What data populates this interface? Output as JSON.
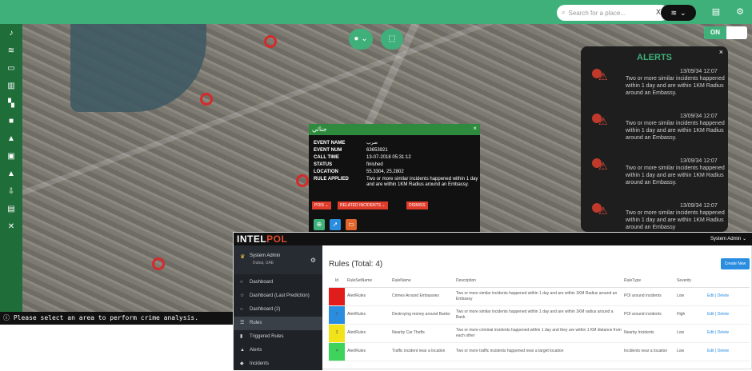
{
  "topbar": {
    "search_placeholder": "Search for a place...",
    "clear_label": "X",
    "layers_icon": "layers-icon",
    "chevron": "⌄"
  },
  "map": {
    "toggle_label": "ON",
    "status_message": "Please select an area to perform crime analysis."
  },
  "alerts": {
    "title": "ALERTS",
    "close": "×",
    "items": [
      {
        "time": "13/09/34 12:07",
        "message": "Two or more similar incidents happened within 1 day and are within 1KM Radius around an Embassy."
      },
      {
        "time": "13/09/34 12:07",
        "message": "Two or more similar incidents happened within 1 day and are within 1KM Radius around an Embassy."
      },
      {
        "time": "13/09/34 12:07",
        "message": "Two or more similar incidents happened within 1 day and are within 1KM Radius around an Embassy."
      },
      {
        "time": "13/09/34 12:07",
        "message": "Two or more similar incidents happened within 1 day and are within 1KM Radius around an Embassy"
      }
    ]
  },
  "popup": {
    "title": "جنائي",
    "close": "×",
    "fields": [
      {
        "key": "EVENT NAME",
        "value": "ضرب"
      },
      {
        "key": "EVENT NUM",
        "value": "63653921"
      },
      {
        "key": "CALL TIME",
        "value": "13-07-2018 05:31:12"
      },
      {
        "key": "STATUS",
        "value": "finished"
      },
      {
        "key": "LOCATION",
        "value": "55.3304, 25.2802"
      },
      {
        "key": "RULE APPLIED",
        "value": "Two or more similar incidents happened within 1 day and are within 1KM Radius around an Embassy."
      }
    ],
    "buttons": [
      "POIS ⌄",
      "RELATED INCIDENTS ⌄",
      "DISMISS"
    ]
  },
  "admin": {
    "logo_intel": "INTEL",
    "logo_pol": "POL",
    "top_user": "System Admin ⌄",
    "profile_name": "System Admin",
    "profile_location": "Dubai, UAE",
    "menu": [
      {
        "label": "Dashboard",
        "icon": "○"
      },
      {
        "label": "Dashboard (Last Prediction)",
        "icon": "☆"
      },
      {
        "label": "Dashboard (2)",
        "icon": "○"
      },
      {
        "label": "Rules",
        "icon": "☰"
      },
      {
        "label": "Triggered Rules",
        "icon": "▮"
      },
      {
        "label": "Alerts",
        "icon": "▲"
      },
      {
        "label": "Incidents",
        "icon": "◆"
      }
    ],
    "page_title": "Rules (Total: 4)",
    "create_label": "Create New",
    "table": {
      "headers": [
        "Id",
        "RuleSetName",
        "RuleName",
        "Description",
        "RuleType",
        "Severity",
        ""
      ],
      "rows": [
        {
          "color": "#e41b1b",
          "id": "1",
          "set": "AlertRules",
          "name": "Crimes Around Embassies",
          "desc": "Two or more similar incidents happened within 1 day and are within 1KM Radius around an Embassy",
          "type": "POI around incidents",
          "sev": "Low",
          "action": "Edit | Delete"
        },
        {
          "color": "#2a8de0",
          "id": "2",
          "set": "AlertRules",
          "name": "Destroying money around Banks",
          "desc": "Two or more similar incidents happened within 1 day and are within 1KM radius around a Bank",
          "type": "POI around incidents",
          "sev": "High",
          "action": "Edit | Delete"
        },
        {
          "color": "#f2e21a",
          "id": "3",
          "set": "AlertRules",
          "name": "Nearby Car Thefts",
          "desc": "Two or more criminal incidents happened within 1 day and they are within 1 KM distance from each other",
          "type": "Nearby Incidents",
          "sev": "Low",
          "action": "Edit | Delete"
        },
        {
          "color": "#3ed35a",
          "id": "4",
          "set": "AlertRules",
          "name": "Traffic incident near a location",
          "desc": "Two or more traffic incidents happened near a target location",
          "type": "Incidents near a location",
          "sev": "Low",
          "action": "Edit | Delete"
        }
      ]
    }
  }
}
